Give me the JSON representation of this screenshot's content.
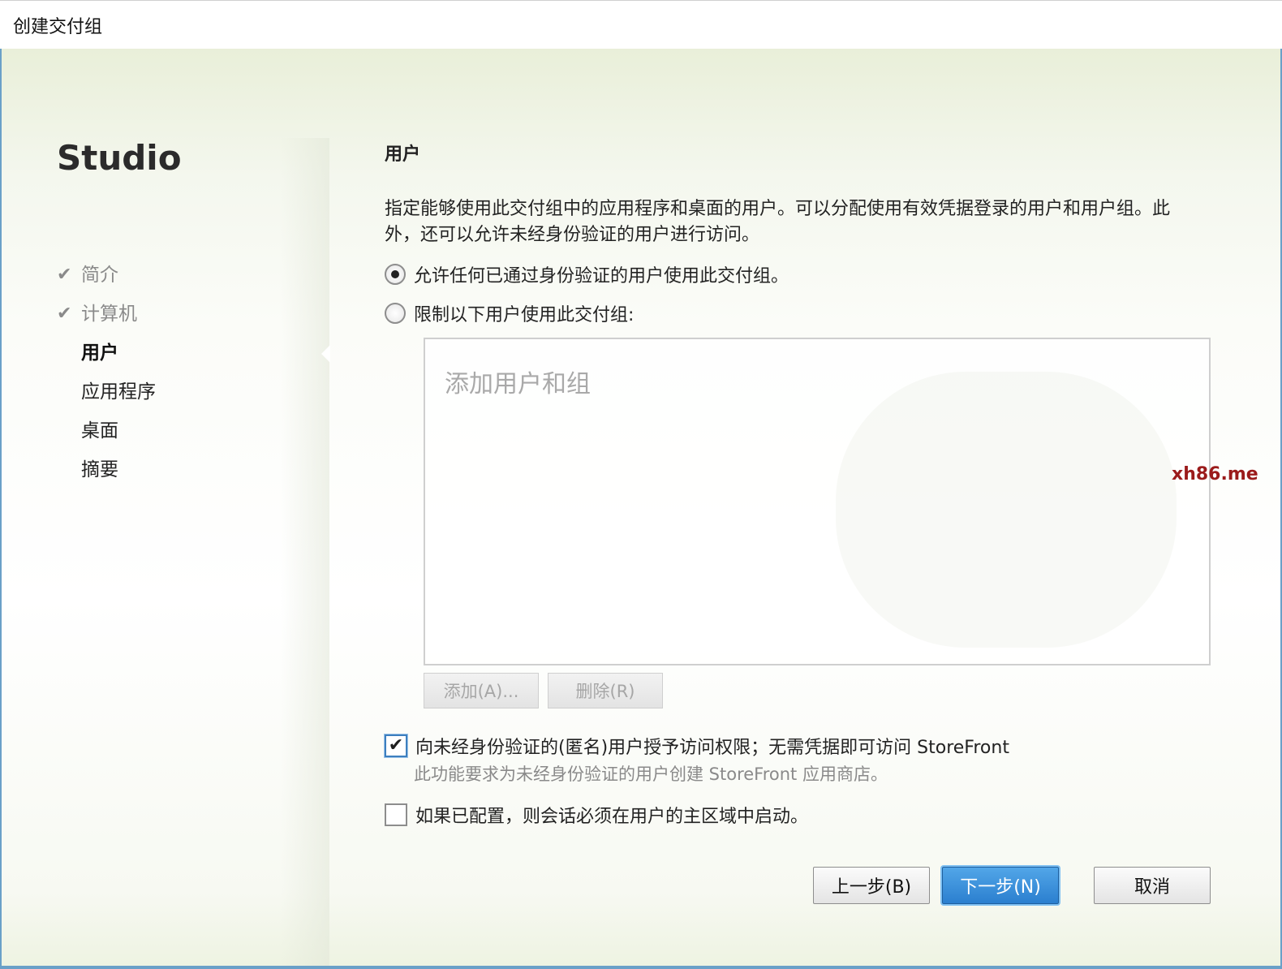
{
  "window": {
    "title": "创建交付组"
  },
  "sidebar": {
    "brand": "Studio",
    "steps": [
      {
        "label": "简介",
        "state": "done"
      },
      {
        "label": "计算机",
        "state": "done"
      },
      {
        "label": "用户",
        "state": "current"
      },
      {
        "label": "应用程序",
        "state": "pending"
      },
      {
        "label": "桌面",
        "state": "pending"
      },
      {
        "label": "摘要",
        "state": "pending"
      }
    ],
    "check_glyph": "✔"
  },
  "main": {
    "title": "用户",
    "description": "指定能够使用此交付组中的应用程序和桌面的用户。可以分配使用有效凭据登录的用户和用户组。此外，还可以允许未经身份验证的用户进行访问。",
    "radio_any": {
      "label": "允许任何已通过身份验证的用户使用此交付组。",
      "checked": true
    },
    "radio_restrict": {
      "label": "限制以下用户使用此交付组:",
      "checked": false
    },
    "user_list": {
      "placeholder": "添加用户和组"
    },
    "add_button": "添加(A)...",
    "remove_button": "删除(R)",
    "anonymous_checkbox": {
      "label": "向未经身份验证的(匿名)用户授予访问权限；无需凭据即可访问 StoreFront",
      "checked": true
    },
    "anonymous_hint": "此功能要求为未经身份验证的用户创建 StoreFront 应用商店。",
    "home_zone_checkbox": {
      "label": "如果已配置，则会话必须在用户的主区域中启动。",
      "checked": false
    }
  },
  "footer": {
    "back_button": "上一步(B)",
    "next_button": "下一步(N)",
    "cancel_button": "取消"
  },
  "watermark": "xh86.me",
  "colors": {
    "primary_button": "#2b7fcf",
    "window_border": "#6aa0c8",
    "disabled_text": "#a6a6a6",
    "watermark": "#9b1b1b"
  }
}
